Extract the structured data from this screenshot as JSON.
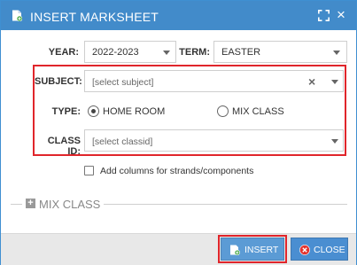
{
  "dialog": {
    "title": "INSERT MARKSHEET",
    "icon": "add-document-icon"
  },
  "fields": {
    "year": {
      "label": "YEAR:",
      "value": "2022-2023"
    },
    "term": {
      "label": "TERM:",
      "value": "EASTER"
    },
    "subject": {
      "label": "SUBJECT:",
      "placeholder": "[select subject]"
    },
    "type": {
      "label": "TYPE:",
      "options": [
        {
          "label": "HOME ROOM",
          "selected": true
        },
        {
          "label": "MIX CLASS",
          "selected": false
        }
      ]
    },
    "class_id": {
      "label": "CLASS ID:",
      "placeholder": "[select classid]"
    },
    "add_columns": {
      "label": "Add columns for strands/components",
      "checked": false
    }
  },
  "mix_class_section": {
    "title": "MIX CLASS"
  },
  "buttons": {
    "insert": "INSERT",
    "close": "CLOSE"
  },
  "colors": {
    "titlebar": "#428bca",
    "insert_button": "#5b9bd5",
    "close_button": "#4a8ed1",
    "highlight": "#e0252b"
  }
}
